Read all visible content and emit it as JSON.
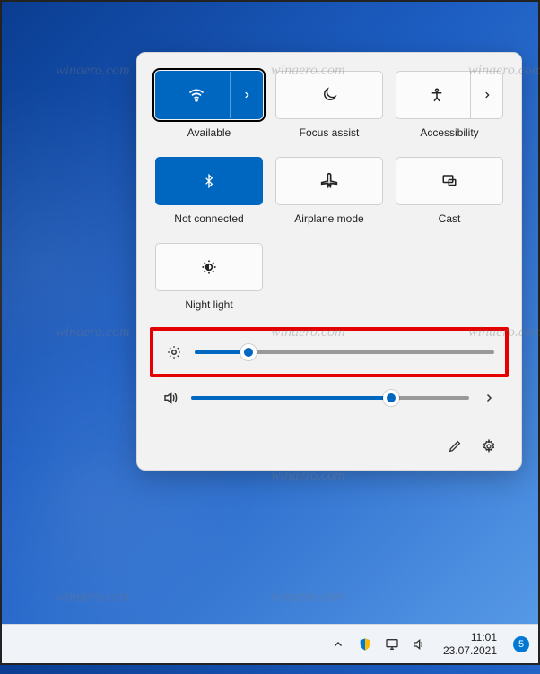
{
  "quick_settings": {
    "tiles": [
      {
        "id": "wifi",
        "label": "Available",
        "active": true,
        "has_arrow": true,
        "focused": true
      },
      {
        "id": "focus-assist",
        "label": "Focus assist",
        "active": false,
        "has_arrow": false,
        "focused": false
      },
      {
        "id": "accessibility",
        "label": "Accessibility",
        "active": false,
        "has_arrow": true,
        "focused": false
      },
      {
        "id": "bluetooth",
        "label": "Not connected",
        "active": true,
        "has_arrow": false,
        "focused": false
      },
      {
        "id": "airplane",
        "label": "Airplane mode",
        "active": false,
        "has_arrow": false,
        "focused": false
      },
      {
        "id": "cast",
        "label": "Cast",
        "active": false,
        "has_arrow": false,
        "focused": false
      },
      {
        "id": "night-light",
        "label": "Night light",
        "active": false,
        "has_arrow": false,
        "focused": false
      }
    ],
    "brightness": {
      "value_percent": 18,
      "highlighted": true
    },
    "volume": {
      "value_percent": 72,
      "has_arrow": true
    }
  },
  "taskbar": {
    "time": "11:01",
    "date": "23.07.2021",
    "notification_count": "5"
  },
  "watermark_text": "winaero.com"
}
